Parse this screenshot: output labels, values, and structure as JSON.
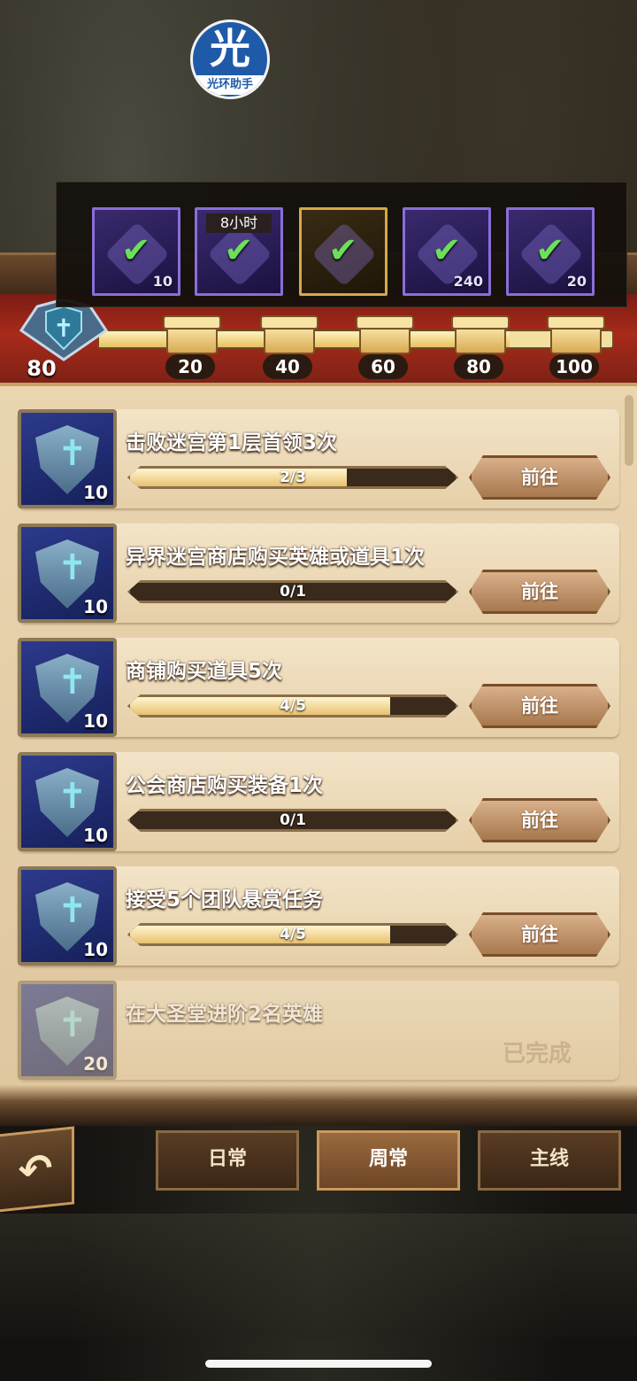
{
  "watermark": {
    "char": "光",
    "text": "光环助手"
  },
  "header": {
    "current_points": "80",
    "progress_fraction": 0.8,
    "milestones": [
      "20",
      "40",
      "60",
      "80",
      "100"
    ]
  },
  "reward_popup": {
    "items": [
      {
        "qty": "10",
        "timer": "",
        "gold": false,
        "checked": true
      },
      {
        "qty": "",
        "timer": "8小时",
        "gold": false,
        "checked": true
      },
      {
        "qty": "",
        "timer": "",
        "gold": true,
        "checked": true
      },
      {
        "qty": "240",
        "timer": "",
        "gold": false,
        "checked": true
      },
      {
        "qty": "20",
        "timer": "",
        "gold": false,
        "checked": true
      }
    ],
    "check_glyph": "✔"
  },
  "tasks": [
    {
      "title": "击败迷宫第1层首领3次",
      "progress": "2/3",
      "fraction": 0.667,
      "points": "10",
      "button": "前往",
      "done": false
    },
    {
      "title": "异界迷宫商店购买英雄或道具1次",
      "progress": "0/1",
      "fraction": 0,
      "points": "10",
      "button": "前往",
      "done": false
    },
    {
      "title": "商铺购买道具5次",
      "progress": "4/5",
      "fraction": 0.8,
      "points": "10",
      "button": "前往",
      "done": false
    },
    {
      "title": "公会商店购买装备1次",
      "progress": "0/1",
      "fraction": 0,
      "points": "10",
      "button": "前往",
      "done": false
    },
    {
      "title": "接受5个团队悬赏任务",
      "progress": "4/5",
      "fraction": 0.8,
      "points": "10",
      "button": "前往",
      "done": false
    },
    {
      "title": "在大圣堂进阶2名英雄",
      "progress": "",
      "fraction": 1,
      "points": "20",
      "button": "",
      "done": true,
      "done_label": "已完成"
    }
  ],
  "tabs": [
    {
      "label": "日常",
      "active": false
    },
    {
      "label": "周常",
      "active": true
    },
    {
      "label": "主线",
      "active": false
    }
  ],
  "back_icon": "↶"
}
